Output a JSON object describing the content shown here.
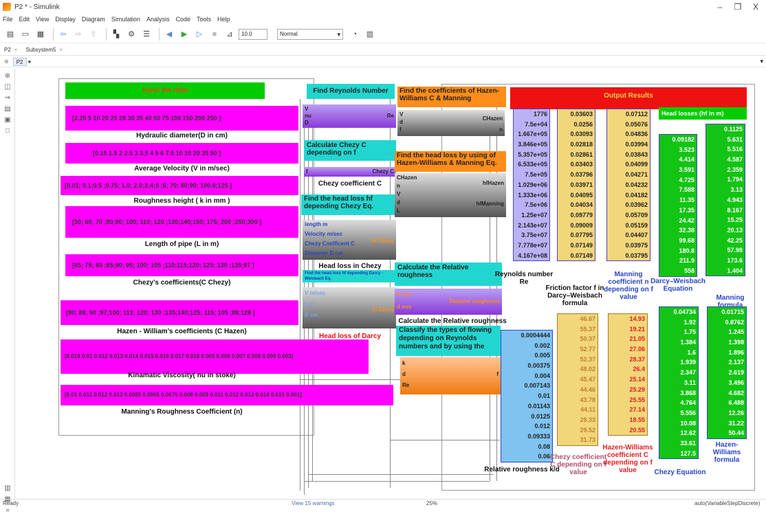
{
  "window": {
    "title": "P2 * - Simulink",
    "minimize": "–",
    "restore": "❐",
    "close": "X"
  },
  "menu": [
    "File",
    "Edit",
    "View",
    "Display",
    "Diagram",
    "Simulation",
    "Analysis",
    "Code",
    "Tools",
    "Help"
  ],
  "toolbar": {
    "stop_time": "10.0",
    "sim_mode": "Normal"
  },
  "tabs": [
    {
      "label": "P2"
    },
    {
      "label": "Subsystem5"
    }
  ],
  "breadcrumb": "P2",
  "status": {
    "left": "Ready",
    "warnings": "View 15 warnings",
    "zoom": "25%",
    "solver": "auto(VariableStepDiscrete)"
  },
  "input": {
    "title": "Input the data",
    "hydraulic_values": "[2.25  5  10  20  25  28  30  35  40  50  75  100  150  200  250 ]",
    "hydraulic_label": "Hydraulic diameter(D in cm)",
    "velocity_values": "[0.15  1.5  2  2.5 3  3.5 4  5  6  7.5  10  15 20  35 50  ]",
    "velocity_label": "Average Velocity (V in m/sec)",
    "roughness_values": "[0.01; 0.1;0.5 ;0.75; 1.0; 2.0;3;4;5 ;6; 70; 80;90; 100.0;125 ]",
    "roughness_label": "Roughness height ( k in mm )",
    "length_values": "[50; 60; 70 ;80;90; 100; 110; 120 ;130;140;150; 175; 200 ;250;300 ]",
    "length_label": "Length of pipe (L in m)",
    "chezy_values": "[65; 75; 80 ;85;90; 95; 100; 105 ;110;115;120; 125; 130 ;135;97 ]",
    "chezy_label": "Chezy’s coefficients(C Chezy)",
    "hazen_values": "[80; 88; 90 ;97;100; 113; 120; 130 ;135;140;125; 115; 105 ;88;128 ]",
    "hazen_label": "Hazen - William’s coefficients (C Hazen)",
    "viscosity_values": "[0.019 0.01 0.012 0.013 0.014 0.015 0.016 0.017 0.018 0.005 0.006 0.007 0.008 0.009  0.003]",
    "viscosity_label": "Kinamatic Viscosity( nu in stoke)",
    "manning_values": "[0.01 0.011 0.012 0.013 0.0085 0.0065 0.0075 0.008 0.009 0.011 0.012 0.013 0.014 0.015 0.001]",
    "manning_label": "Manning's Roughness Coefficient (n)"
  },
  "middle": {
    "reynolds_title": "Find Reynolds Number",
    "reynolds_ports": [
      "V",
      "nu",
      "D"
    ],
    "reynolds_out": "Re",
    "chezy_title": "Calculate Chezy C depending on f",
    "chezy_in": "f",
    "chezy_out": "Chezy C",
    "chezy_label": "Chezy coefficient C",
    "hf_chezy_title": "Find the head loss hf depending Chezy Eq.",
    "hf_chezy_ports": [
      "length m",
      "Velocity m/sec",
      "Chezy Coefficent C",
      "Diameter D cm"
    ],
    "hf_chezy_out": "hf Chezy",
    "hf_chezy_label": "Head loss in Chezy",
    "darcy_title": "Find the head loss hf depending Darcy - Weisbach Eq.",
    "darcy_ports": [
      "V m/sec",
      "L m",
      "D cm"
    ],
    "darcy_out": "hf Darcy",
    "darcy_label": "Head loss of Darcy"
  },
  "right_mid": {
    "coef_title": "Find the coefficients of Hazen-Williams C & Manning",
    "coef_ports": [
      "V",
      "d",
      "f"
    ],
    "coef_out_c": "CHazen",
    "coef_out_n": "n",
    "headloss_title": "Find the head loss by using of Hazen-Williams  & Manning Eq.",
    "headloss_ports": [
      "CHazen",
      "n",
      "V",
      "d",
      "L"
    ],
    "headloss_out1": "hfHazen",
    "headloss_out2": "hfManning",
    "rel_title": "Calculate  the Relative roughness",
    "rel_in1": "k mm",
    "rel_in2": "d mm",
    "rel_out": "Relative roughness",
    "rel_label": "Calculate the Relative roughness",
    "classify_title": "Classify the types of flowing depending on Reynolds numbers and by using the",
    "classify_ports": [
      "k",
      "d",
      "Re"
    ],
    "classify_out": "f"
  },
  "output": {
    "title": "Output Results",
    "headloss_title": "Head losses (hf in m)",
    "reynolds": [
      "1776",
      "7.5e+04",
      "1.667e+05",
      "3.846e+05",
      "5.357e+05",
      "6.533e+05",
      "7.5e+05",
      "1.029e+06",
      "1.333e+06",
      "7.5e+06",
      "1.25e+07",
      "2.143e+07",
      "3.75e+07",
      "7.778e+07",
      "4.167e+08"
    ],
    "reynolds_label": "Reynolds number Re",
    "friction": [
      "0.03603",
      "0.0256",
      "0.03093",
      "0.02818",
      "0.02861",
      "0.03403",
      "0.03796",
      "0.03971",
      "0.04095",
      "0.04034",
      "0.09779",
      "0.09009",
      "0.07795",
      "0.07149",
      "0.07149"
    ],
    "friction_label": "Friction factor f in Darcy–Weisbach formula",
    "manning_coef": [
      "0.07112",
      "0.05076",
      "0.04836",
      "0.03994",
      "0.03843",
      "0.04099",
      "0.04271",
      "0.04232",
      "0.04182",
      "0.03962",
      "0.05709",
      "0.05159",
      "0.04407",
      "0.03975",
      "0.03795"
    ],
    "manning_coef_label": "Manning coefficient n depending on f value",
    "darcy": [
      "0.09182",
      "3.523",
      "4.414",
      "3.591",
      "4.725",
      "7.588",
      "11.35",
      "17.35",
      "24.42",
      "32.38",
      "99.68",
      "180.8",
      "211.9",
      "558"
    ],
    "darcy_label": "Darcy–Weisbach Equation",
    "manning_hf": [
      "0.1125",
      "5.631",
      "5.516",
      "4.587",
      "2.359",
      "1.794",
      "3.13",
      "4.943",
      "8.167",
      "15.25",
      "20.13",
      "42.25",
      "57.98",
      "173.6",
      "1.404"
    ],
    "manning_hf_label": "Manning formula",
    "relative": [
      "0.0004444",
      "0.002",
      "0.005",
      "0.00375",
      "0.004",
      "0.007143",
      "0.01",
      "0.01143",
      "0.0125",
      "0.012",
      "0.09333",
      "0.08",
      "0.06"
    ],
    "relative_label": "Relative roughness k/d",
    "chezy_c": [
      "46.67",
      "55.37",
      "50.37",
      "52.77",
      "52.37",
      "48.02",
      "45.47",
      "44.46",
      "43.78",
      "44.11",
      "28.33",
      "29.52",
      "31.73"
    ],
    "chezy_c_label": "Chezy coefficient C depending on f value",
    "hazen_c": [
      "14.93",
      "19.21",
      "21.05",
      "27.06",
      "28.37",
      "26.4",
      "25.14",
      "25.29",
      "25.55",
      "27.14",
      "18.55",
      "20.55"
    ],
    "hazen_c_label": "Hazen-Williams coefficient C depending on f value",
    "chezy_hf": [
      "0.04734",
      "1.92",
      "1.75",
      "1.384",
      "1.6",
      "1.939",
      "2.347",
      "3.11",
      "3.868",
      "4.764",
      "5.556",
      "10.08",
      "12.62",
      "33.61",
      "127.5"
    ],
    "chezy_hf_label": "Chezy Equation",
    "hazen_hf": [
      "0.01715",
      "0.8762",
      "1.245",
      "1.398",
      "1.896",
      "2.137",
      "2.619",
      "3.496",
      "4.682",
      "6.488",
      "12.26",
      "31.22",
      "50.44"
    ],
    "hazen_hf_label": "Hazen-Williams formula"
  },
  "colors": {
    "pink": "#ff00ff",
    "green": "#00cc00",
    "cyan": "#22d6d0",
    "orange": "#ff8d1a",
    "red": "#ee1111",
    "display_blue": "#b9b2f4",
    "display_yellow": "#f2d67a",
    "display_green": "#14c414",
    "display_lightblue": "#7fc3f0"
  }
}
